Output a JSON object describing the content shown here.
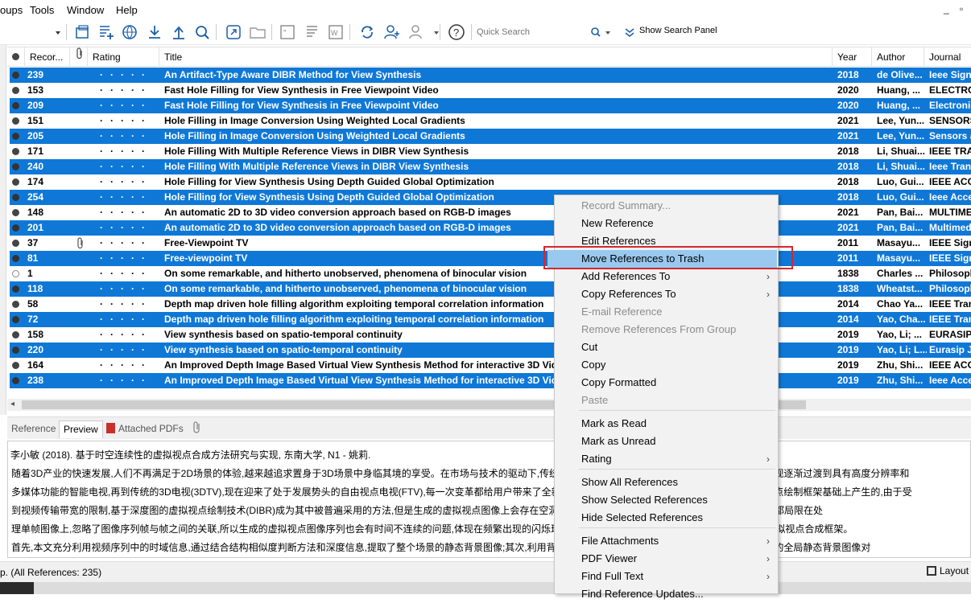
{
  "menubar": {
    "items": [
      "oups",
      "Tools",
      "Window",
      "Help"
    ],
    "minimize": "_",
    "restore": "▫"
  },
  "toolbar": {
    "quick_search_placeholder": "Quick Search",
    "show_search_panel": "Show Search Panel"
  },
  "columns": {
    "read": "",
    "record": "Recor...",
    "attach": "",
    "rating": "Rating",
    "title": "Title",
    "year": "Year",
    "author": "Author",
    "journal": "Journal"
  },
  "rows": [
    {
      "rec": "239",
      "title": "An Artifact-Type Aware DIBR Method for View Synthesis",
      "year": "2018",
      "author": "de Olive...",
      "journal": "Ieee Signa",
      "sel": true
    },
    {
      "rec": "153",
      "title": "Fast Hole Filling for View Synthesis in Free Viewpoint Video",
      "year": "2020",
      "author": "Huang, ...",
      "journal": "ELECTRON",
      "sel": false
    },
    {
      "rec": "209",
      "title": "Fast Hole Filling for View Synthesis in Free Viewpoint Video",
      "year": "2020",
      "author": "Huang, ...",
      "journal": "Electronic",
      "sel": true
    },
    {
      "rec": "151",
      "title": "Hole Filling in Image Conversion Using Weighted Local Gradients",
      "year": "2021",
      "author": "Lee, Yun...",
      "journal": "SENSORS",
      "sel": false
    },
    {
      "rec": "205",
      "title": "Hole Filling in Image Conversion Using Weighted Local Gradients",
      "year": "2021",
      "author": "Lee, Yun...",
      "journal": "Sensors a",
      "sel": true
    },
    {
      "rec": "171",
      "title": "Hole Filling With Multiple Reference Views in DIBR View Synthesis",
      "year": "2018",
      "author": "Li, Shuai...",
      "journal": "IEEE TRAN",
      "sel": false
    },
    {
      "rec": "240",
      "title": "Hole Filling With Multiple Reference Views in DIBR View Synthesis",
      "year": "2018",
      "author": "Li, Shuai...",
      "journal": "Ieee Tran",
      "sel": true
    },
    {
      "rec": "174",
      "title": "Hole Filling for View Synthesis Using Depth Guided Global Optimization",
      "year": "2018",
      "author": "Luo, Gui...",
      "journal": "IEEE ACCE",
      "sel": false
    },
    {
      "rec": "254",
      "title": "Hole Filling for View Synthesis Using Depth Guided Global Optimization",
      "year": "2018",
      "author": "Luo, Gui...",
      "journal": "Ieee Acce",
      "sel": true
    },
    {
      "rec": "148",
      "title": "An automatic 2D to 3D video conversion approach based on RGB-D images",
      "year": "2021",
      "author": "Pan, Bai...",
      "journal": "MULTIME",
      "sel": false
    },
    {
      "rec": "201",
      "title": "An automatic 2D to 3D video conversion approach based on RGB-D images",
      "year": "2021",
      "author": "Pan, Bai...",
      "journal": "Multimed",
      "sel": true
    },
    {
      "rec": "37",
      "title": "Free-Viewpoint TV",
      "year": "2011",
      "author": "Masayu...",
      "journal": "IEEE Signa",
      "sel": false,
      "clip": true
    },
    {
      "rec": "81",
      "title": "Free-viewpoint TV",
      "year": "2011",
      "author": "Masayu...",
      "journal": "IEEE Signa",
      "sel": true
    },
    {
      "rec": "1",
      "title": "On some remarkable, and hitherto unobserved, phenomena of binocular vision",
      "year": "1838",
      "author": "Charles ...",
      "journal": "Philosoph",
      "sel": false,
      "read": true
    },
    {
      "rec": "118",
      "title": "On some remarkable, and hitherto unobserved, phenomena of binocular vision",
      "year": "1838",
      "author": "Wheatst...",
      "journal": "Philosoph",
      "sel": true
    },
    {
      "rec": "58",
      "title": "Depth map driven hole filling algorithm exploiting temporal correlation information",
      "year": "2014",
      "author": "Chao Ya...",
      "journal": "IEEE Trans",
      "sel": false
    },
    {
      "rec": "72",
      "title": "Depth map driven hole filling algorithm exploiting temporal correlation information",
      "year": "2014",
      "author": "Yao, Cha...",
      "journal": "IEEE Trans",
      "sel": true
    },
    {
      "rec": "158",
      "title": "View synthesis based on spatio-temporal continuity",
      "year": "2019",
      "author": "Yao, Li; ...",
      "journal": "EURASIP",
      "sel": false
    },
    {
      "rec": "220",
      "title": "View synthesis based on spatio-temporal continuity",
      "year": "2019",
      "author": "Yao, Li; L...",
      "journal": "Eurasip Jo",
      "sel": true
    },
    {
      "rec": "164",
      "title": "An Improved Depth Image Based Virtual View Synthesis Method for interactive 3D Vid",
      "year": "2019",
      "author": "Zhu, Shi...",
      "journal": "IEEE ACCE",
      "sel": false
    },
    {
      "rec": "238",
      "title": "An Improved Depth Image Based Virtual View Synthesis Method for interactive 3D Vid",
      "year": "2019",
      "author": "Zhu, Shi...",
      "journal": "Ieee Acce",
      "sel": true
    }
  ],
  "tabs": {
    "reference": "Reference",
    "preview": "Preview",
    "pdfs": "Attached PDFs"
  },
  "preview": {
    "citation": "李小敏 (2018). 基于时空连续性的虚拟视点合成方法研究与实现, 东南大学, N1 - 姚莉.",
    "lines": [
      "        随着3D产业的快速发展,人们不再满足于2D场景的体验,越来越追求置身于3D场景中身临其境的享受。在市场与技术的驱动下,传统的二维视频正在逐渐向三维视频转变,色彩的传统电视逐渐过渡到具有高度分辨率和",
      "        多媒体功能的智能电视,再到传统的3D电视(3DTV),现在迎来了处于发展势头的自由视点电视(FTV),每一次变革都给用户带来了全新的体验。本文在基于深度图像渲染(DIBR)的虚拟视点绘制框架基础上产生的,由于受",
      "        到视频传输带宽的限制,基于深度图的虚拟视点绘制技术(DIBR)成为其中被普遍采用的方法,但是生成的虚拟视点图像上会存在空洞等问题需要修复。目前大部分DIBR技术的解决方法都局限在处",
      "        理单帧图像上,忽略了图像序列帧与帧之间的关联,所以生成的虚拟视点图像序列也会有时间不连续的问题,体现在频繁出现的闪烁现象。针对以上问题,本文提出了基于时空连续性的虚拟视点合成框架。",
      "        首先,本文充分利用视频序列中的时域信息,通过结合结构相似度判断方法和深度信息,提取了整个场景的静态背景图像;其次,利用背景图像对空洞进行预填充处理,减,并利用本文提取到的全局静态背景图像对"
    ]
  },
  "status": "p. (All References: 235)",
  "layout_label": "Layout",
  "context_menu": [
    {
      "label": "Record Summary...",
      "disabled": true
    },
    {
      "label": "New Reference"
    },
    {
      "label": "Edit References"
    },
    {
      "label": "Move References to Trash",
      "highlighted": true
    },
    {
      "label": "Add References To",
      "submenu": true
    },
    {
      "label": "Copy References To",
      "submenu": true
    },
    {
      "label": "E-mail Reference",
      "disabled": true
    },
    {
      "label": "Remove References From Group",
      "disabled": true
    },
    {
      "label": "Cut"
    },
    {
      "label": "Copy"
    },
    {
      "label": "Copy Formatted"
    },
    {
      "label": "Paste",
      "disabled": true
    },
    {
      "label": "Mark as Read"
    },
    {
      "label": "Mark as Unread"
    },
    {
      "label": "Rating",
      "submenu": true
    },
    {
      "label": "Show All References"
    },
    {
      "label": "Show Selected References"
    },
    {
      "label": "Hide Selected References"
    },
    {
      "label": "File Attachments",
      "submenu": true
    },
    {
      "label": "PDF Viewer",
      "submenu": true
    },
    {
      "label": "Find Full Text",
      "submenu": true
    },
    {
      "label": "Find Reference Updates..."
    }
  ],
  "colors": {
    "selection": "#0f78d7",
    "menu_highlight": "#99c9ef",
    "red_box": "#d7262c"
  }
}
